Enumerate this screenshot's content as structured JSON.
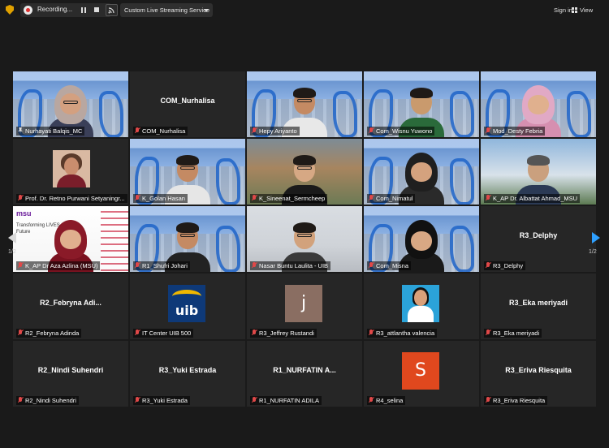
{
  "topbar": {
    "recording_label": "Recording...",
    "streaming_service": "Custom Live Streaming Service",
    "sign_in": "Sign in",
    "view": "View"
  },
  "pagination": {
    "left": "1/2",
    "right": "1/2"
  },
  "tiles": [
    {
      "label": "Nurhayati Balqis_MC",
      "center": "",
      "active": true
    },
    {
      "label": "COM_Nurhalisa",
      "center": "COM_Nurhalisa"
    },
    {
      "label": "Hepy Ariyanto",
      "center": ""
    },
    {
      "label": "Com_Wisnu Yuwono",
      "center": ""
    },
    {
      "label": "Mod_Desty Febria",
      "center": ""
    },
    {
      "label": "Prof. Dr. Retno Purwani Setyaningr...",
      "center": ""
    },
    {
      "label": "K_Golan Hasan",
      "center": ""
    },
    {
      "label": "K_Sineenat_Sermcheep",
      "center": ""
    },
    {
      "label": "Com_Nimatul",
      "center": ""
    },
    {
      "label": "K_AP Dr. Albattat Ahmad_MSU",
      "center": ""
    },
    {
      "label": "K_AP Dr Aza Azlina (MSU)",
      "center": ""
    },
    {
      "label": "R1_Shufri Johari",
      "center": ""
    },
    {
      "label": "Nasar Buntu Laulita - UIB",
      "center": ""
    },
    {
      "label": "Com_Misna",
      "center": ""
    },
    {
      "label": "R3_Delphy",
      "center": "R3_Delphy"
    },
    {
      "label": "R2_Febryna Adinda",
      "center": "R2_Febryna  Adi..."
    },
    {
      "label": "IT Center UIB 500",
      "center": ""
    },
    {
      "label": "R3_Jeffrey Rustandi",
      "center": ""
    },
    {
      "label": "R3_attlantha valencia",
      "center": ""
    },
    {
      "label": "R3_Eka meriyadi",
      "center": "R3_Eka meriyadi"
    },
    {
      "label": "R2_Nindi Suhendri",
      "center": "R2_Nindi Suhendri"
    },
    {
      "label": "R3_Yuki Estrada",
      "center": "R3_Yuki Estrada"
    },
    {
      "label": "R1_NURFATIN ADILA",
      "center": "R1_NURFATIN  A..."
    },
    {
      "label": "R4_selina",
      "center": ""
    },
    {
      "label": "R3_Eriva Riesquita",
      "center": "R3_Eriva Riesquita"
    }
  ],
  "avatars": {
    "uib_text": "uib",
    "jeffrey_initial": "j",
    "selina_initial": "S"
  },
  "msu_tile": {
    "logo": "msu",
    "tagline_1": "Transforming LIVES.",
    "tagline_2": "Future"
  },
  "colors": {
    "active_border": "#d7d44a",
    "muted_mic": "#e04848",
    "nav_right": "#2ea0ff"
  }
}
